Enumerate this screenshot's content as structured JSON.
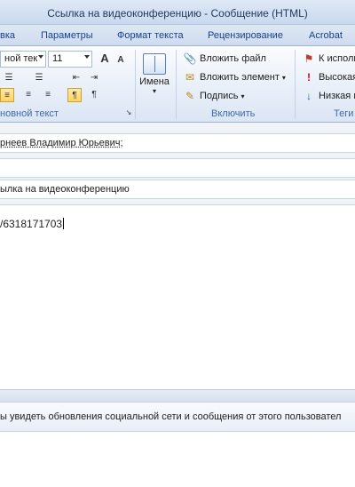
{
  "window": {
    "title": "Ссылка на видеоконференцию  -  Сообщение (HTML)"
  },
  "tabs": [
    "вка",
    "Параметры",
    "Формат текста",
    "Рецензирование",
    "Acrobat"
  ],
  "ribbon": {
    "font_name": "ной тек",
    "font_size": "11",
    "grow_font": "A",
    "shrink_font": "A",
    "basic_text_label": "новной текст",
    "names_label": "Имена",
    "attach_file": "Вложить файл",
    "attach_item": "Вложить элемент",
    "signature": "Подпись",
    "include_label": "Включить",
    "follow_up": "К исполн",
    "high_importance": "Высокая",
    "low_importance": "Низкая в",
    "tags_label": "Теги"
  },
  "message": {
    "to": "рнеев Владимир Юрьевич;",
    "cc": "",
    "subject": "ылка на видеоконференцию",
    "body": "/6318171703"
  },
  "social": {
    "info": "ы увидеть обновления социальной сети и сообщения от этого пользовател"
  }
}
